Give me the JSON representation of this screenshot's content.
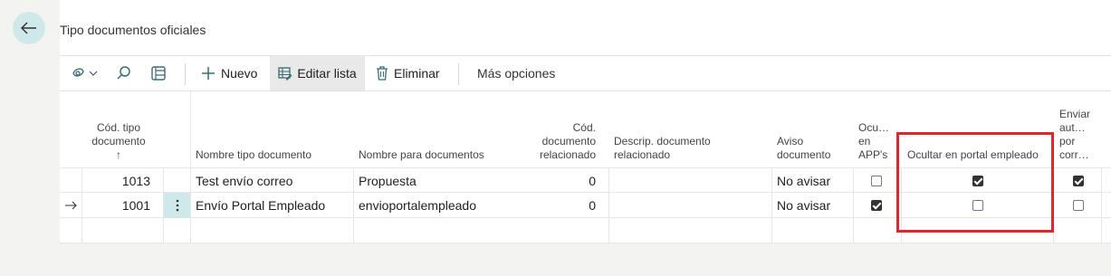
{
  "page": {
    "title": "Tipo documentos oficiales"
  },
  "toolbar": {
    "new_label": "Nuevo",
    "edit_list_label": "Editar lista",
    "delete_label": "Eliminar",
    "more_label": "Más opciones"
  },
  "columns": {
    "code": "Cód. tipo documento",
    "sort_arrow": "↑",
    "name": "Nombre tipo documento",
    "doc_name": "Nombre para documentos",
    "related_code": "Cód. documento relacionado",
    "related_desc": "Descrip. documento relacionado",
    "notice": "Aviso documento",
    "hide_app": "Ocu… en APP's",
    "hide_portal": "Ocultar en portal empleado",
    "send_auto": "Enviar aut… por corr…"
  },
  "rows": [
    {
      "code": "1013",
      "name": "Test envío correo",
      "doc_name": "Propuesta",
      "related_code": "0",
      "related_desc": "",
      "notice": "No avisar",
      "hide_app": false,
      "hide_portal": true,
      "send_auto": true
    },
    {
      "code": "1001",
      "name": "Envío Portal Empleado",
      "doc_name": "envioportalempleado",
      "related_code": "0",
      "related_desc": "",
      "notice": "No avisar",
      "hide_app": true,
      "hide_portal": false,
      "send_auto": false
    }
  ],
  "colors": {
    "accent": "#cfe8ea",
    "highlight": "#e0262b",
    "toolbar_active": "#e9e9e9"
  }
}
